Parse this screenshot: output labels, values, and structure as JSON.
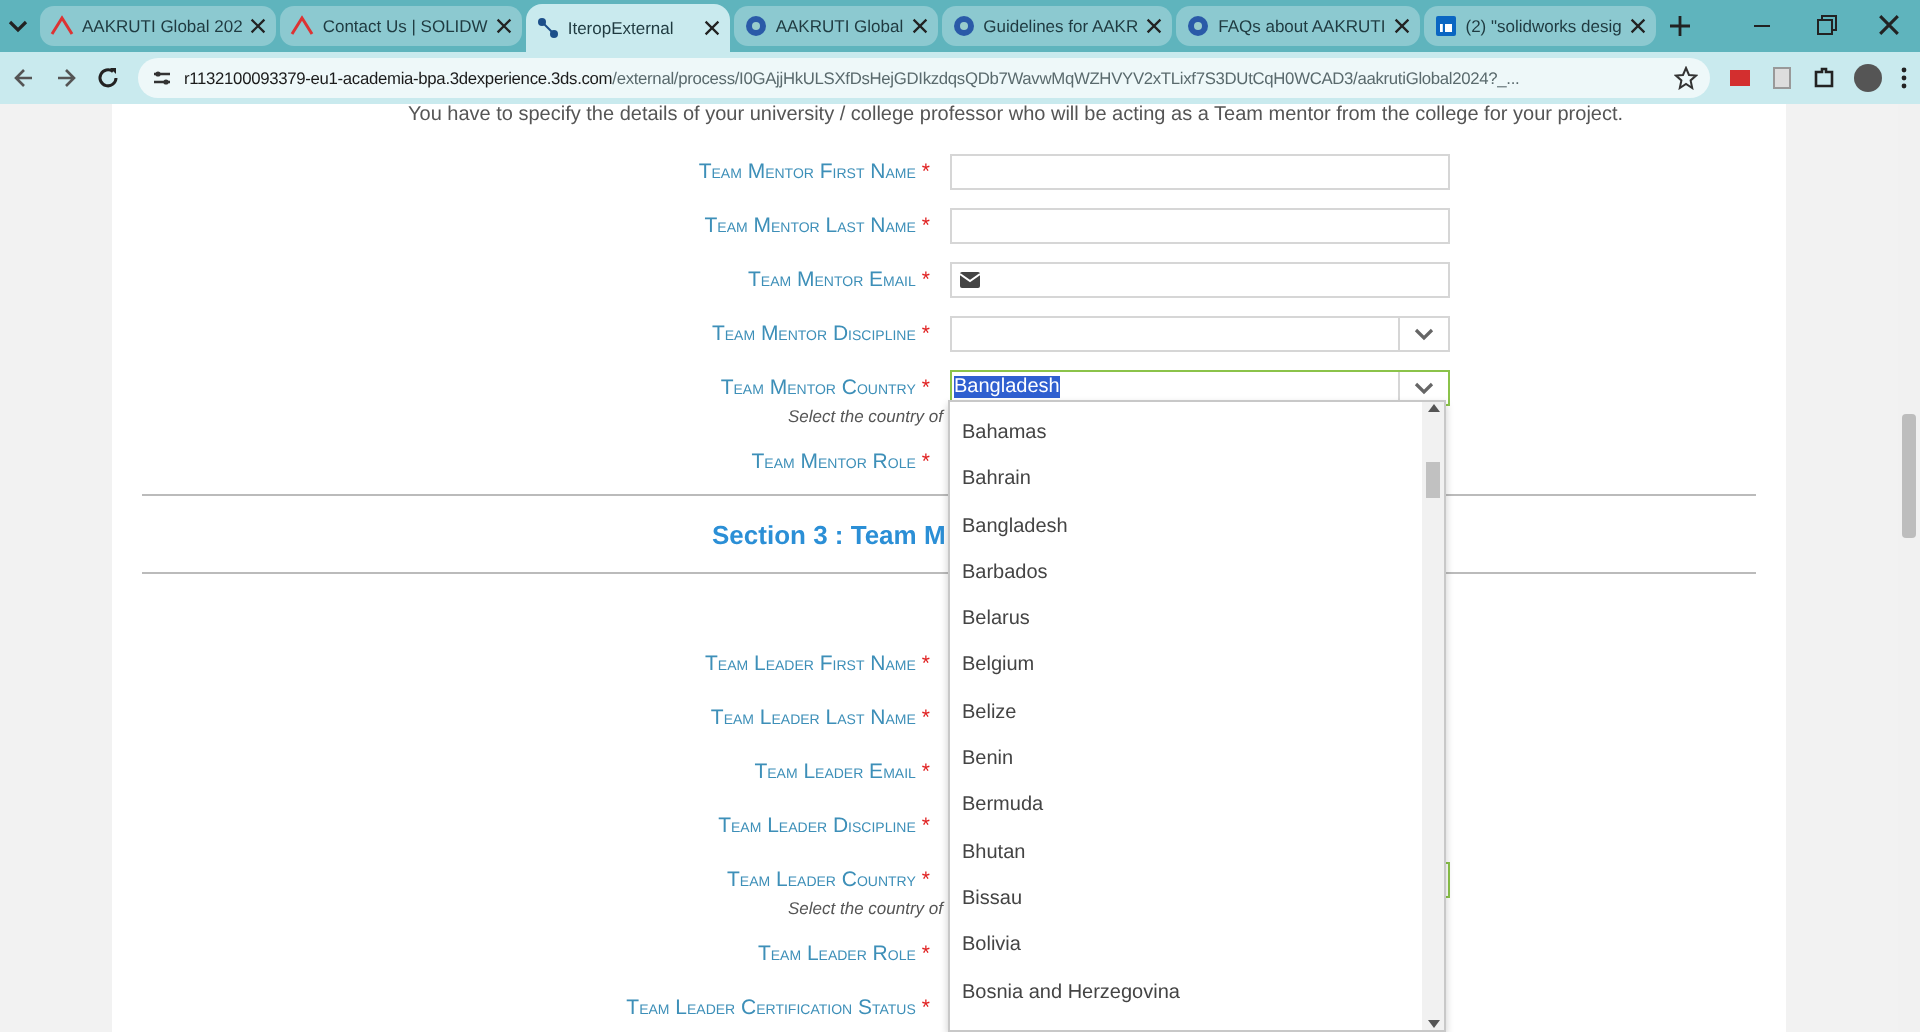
{
  "browser": {
    "tabs": [
      {
        "title": "AAKRUTI Global 202",
        "kind": "logo",
        "selected": false
      },
      {
        "title": "Contact Us | SOLIDW",
        "kind": "logo",
        "selected": false
      },
      {
        "title": "IteropExternal",
        "kind": "flow",
        "selected": true
      },
      {
        "title": "AAKRUTI Global",
        "kind": "globe",
        "selected": false
      },
      {
        "title": "Guidelines for AAKR",
        "kind": "globe",
        "selected": false
      },
      {
        "title": "FAQs about AAKRUTI",
        "kind": "globe",
        "selected": false
      },
      {
        "title": "(2) \"solidworks desig",
        "kind": "in",
        "selected": false
      }
    ],
    "url_host": "r1132100093379-eu1-academia-bpa.3dexperience.3ds.com",
    "url_path": "/external/process/I0GAjjHkULSXfDsHejGDIkzdqsQDb7WavwMqWZHVYV2xTLixf7S3DUtCqH0WCAD3/aakrutiGlobal2024?_..."
  },
  "intro": "You have to specify the details of your university / college professor who will be acting as a Team mentor from the college for your project.",
  "mentor_fields": [
    {
      "label": "Team Mentor First Name",
      "mark": "*",
      "kind": "text",
      "focused": false
    },
    {
      "label": "Team Mentor Last Name",
      "mark": "*",
      "kind": "text",
      "focused": false
    },
    {
      "label": "Team Mentor Email",
      "mark": "*",
      "kind": "email",
      "focused": false
    },
    {
      "label": "Team Mentor Discipline",
      "mark": "*",
      "kind": "select",
      "focused": false
    },
    {
      "label": "Team Mentor Country",
      "mark": "*",
      "kind": "select",
      "focused": true,
      "value": "Bangladesh",
      "highlighted": true,
      "help": "Select the country of"
    },
    {
      "label": "Team Mentor Role",
      "mark": "*"
    }
  ],
  "section_heading": "Section 3 : Team M",
  "leader_fields": [
    {
      "label": "Team Leader First Name",
      "mark": "*"
    },
    {
      "label": "Team Leader Last Name",
      "mark": "*"
    },
    {
      "label": "Team Leader Email",
      "mark": "*"
    },
    {
      "label": "Team Leader Discipline",
      "mark": "*"
    },
    {
      "label": "Team Leader Country",
      "mark": "*",
      "focused": true,
      "help": "Select the country of"
    },
    {
      "label": "Team Leader Role",
      "mark": "*"
    },
    {
      "label": "Team Leader Certification Status",
      "mark": "*"
    }
  ],
  "dropdown_options": [
    "Bahamas",
    "Bahrain",
    "Bangladesh",
    "Barbados",
    "Belarus",
    "Belgium",
    "Belize",
    "Benin",
    "Bermuda",
    "Bhutan",
    "Bissau",
    "Bolivia",
    "Bosnia and Herzegovina"
  ]
}
